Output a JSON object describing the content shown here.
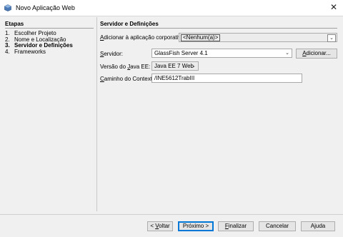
{
  "window": {
    "title": "Novo Aplicação Web",
    "close_glyph": "✕"
  },
  "steps": {
    "title": "Etapas",
    "items": [
      {
        "num": "1.",
        "label": "Escolher Projeto",
        "current": false
      },
      {
        "num": "2.",
        "label": "Nome e Localização",
        "current": false
      },
      {
        "num": "3.",
        "label": "Servidor e Definições",
        "current": true
      },
      {
        "num": "4.",
        "label": "Frameworks",
        "current": false
      }
    ]
  },
  "panel": {
    "title": "Servidor e Definições",
    "enterprise": {
      "label_ul": "A",
      "label_rest": "dicionar à aplicação corporativa:",
      "value": "<Nenhum(a)>"
    },
    "server": {
      "label_ul": "S",
      "label_rest": "ervidor:",
      "value": "GlassFish Server 4.1",
      "add_button_pre": "A",
      "add_button_rest": "dicionar..."
    },
    "java_ee": {
      "label_pre": "Versão do ",
      "label_ul": "J",
      "label_rest": "ava EE:",
      "value": "Java EE 7 Web"
    },
    "context_path": {
      "label_ul": "C",
      "label_rest": "aminho do Contexto:",
      "value": "/INE5612TrabIII"
    }
  },
  "footer": {
    "back_ul": "V",
    "back_pre": "< ",
    "back_rest": "oltar",
    "next_label": "Próximo >",
    "finish_ul": "F",
    "finish_rest": "inalizar",
    "cancel_label": "Cancelar",
    "help_ul": "j",
    "help_pre": "A",
    "help_rest": "uda"
  },
  "colors": {
    "accent": "#0078d7",
    "window_bg": "#f0f0f0"
  },
  "icons": {
    "app": "netbeans-cube-icon",
    "close": "close-icon",
    "dropdown": "chevron-down-icon"
  }
}
